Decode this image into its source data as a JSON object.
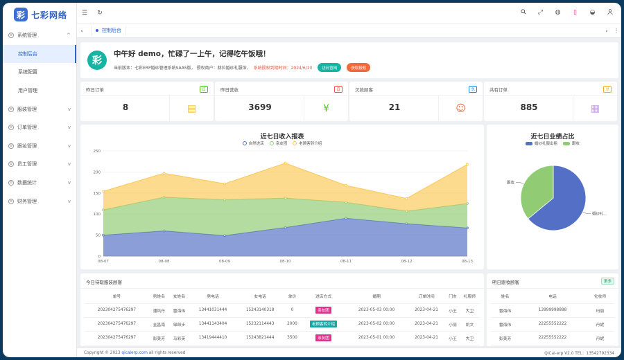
{
  "app": {
    "logo_char": "彩",
    "name": "七彩网络"
  },
  "sidebar": {
    "items": [
      {
        "label": "系统管理",
        "type": "group",
        "chev": "^"
      },
      {
        "label": "控制后台",
        "type": "sub",
        "active": true
      },
      {
        "label": "系统配置",
        "type": "sub"
      },
      {
        "label": "用户管理",
        "type": "sub"
      },
      {
        "label": "服装管理",
        "type": "group",
        "chev": "v"
      },
      {
        "label": "订单管理",
        "type": "group",
        "chev": "v"
      },
      {
        "label": "跟妆管理",
        "type": "group",
        "chev": "v"
      },
      {
        "label": "员工管理",
        "type": "group",
        "chev": "v"
      },
      {
        "label": "数据统计",
        "type": "group",
        "chev": "v"
      },
      {
        "label": "财务管理",
        "type": "group",
        "chev": "v"
      }
    ]
  },
  "topbar": {
    "left_icons": [
      "menu-icon",
      "refresh-icon"
    ],
    "right_icons": [
      "search-icon",
      "fullscreen-icon",
      "globe-icon",
      "phone-icon",
      "skin-icon",
      "user-icon"
    ]
  },
  "tabs": {
    "active_label": "控制后台"
  },
  "welcome": {
    "greeting": "中午好 demo，忙碌了一上午，记得吃午饭哦！",
    "version_text": "当前版本：七彩ERP婚纱管理系统SAAS版，  授权商户：赫拉婚纱礼服馆，",
    "expire_text": "系统授权到期时间：2024/6/10",
    "btn_site": "访问官网",
    "btn_auth": "获取授权"
  },
  "stats": [
    {
      "title": "昨日订单",
      "badge": "日",
      "value": "8",
      "badge_color": "#52c41a",
      "icon_color": "#f5c242"
    },
    {
      "title": "昨日营收",
      "badge": "日",
      "value": "3699",
      "badge_color": "#ff4d4f",
      "icon_color": "#52c41a"
    },
    {
      "title": "欠款顾客",
      "badge": "总",
      "value": "21",
      "badge_color": "#1890ff",
      "icon_color": "#f26a3b"
    },
    {
      "title": "共有订单",
      "badge": "总",
      "value": "885",
      "badge_color": "#faad14",
      "icon_color": "#c9a4e8"
    }
  ],
  "chart_data": [
    {
      "type": "area",
      "title": "近七日收入报表",
      "stacked": true,
      "x": [
        "08-07",
        "08-08",
        "08-09",
        "08-10",
        "08-11",
        "08-12",
        "08-13"
      ],
      "ylim": [
        0,
        250
      ],
      "yticks": [
        0,
        50,
        100,
        150,
        200,
        250
      ],
      "series": [
        {
          "name": "自然进店",
          "values": [
            50,
            60,
            49,
            68,
            90,
            77,
            67
          ],
          "color": "#5470c6"
        },
        {
          "name": "亲友团",
          "values": [
            60,
            80,
            85,
            70,
            38,
            30,
            58
          ],
          "color": "#91cc75"
        },
        {
          "name": "老顾客转介绍",
          "values": [
            44,
            57,
            38,
            83,
            40,
            30,
            93
          ],
          "color": "#fac858"
        }
      ]
    },
    {
      "type": "pie",
      "title": "近七日业绩占比",
      "slices": [
        {
          "name": "婚纱礼服出租",
          "value": 64,
          "label": "婚纱礼...",
          "color": "#5470c6"
        },
        {
          "name": "跟妆",
          "value": 36,
          "label": "跟妆",
          "color": "#91cc75"
        }
      ]
    }
  ],
  "left_table": {
    "title": "今日待取服装顾客",
    "headers": [
      "单号",
      "男姓名",
      "女姓名",
      "男电话",
      "女电话",
      "单价",
      "进店方式",
      "婚期",
      "订单时间",
      "门市",
      "礼服师"
    ],
    "rows": [
      [
        "202304275476297",
        "潘风丹",
        "雷海伟",
        "13441031444",
        "15243140318",
        "0",
        "亲友团",
        "2023-05-03 00:00",
        "2023-04-21",
        "小王",
        "大卫"
      ],
      [
        "202304275476297",
        "金昌南",
        "邹郎步",
        "13441143404",
        "15232114443",
        "2000",
        "老顾客转介绍",
        "2023-05-02 00:00",
        "2023-04-21",
        "小丽",
        "凯文"
      ],
      [
        "202304275476297",
        "彭美芳",
        "马彩英",
        "13419444410",
        "15243821444",
        "3500",
        "亲友团",
        "2023-05-01 00:00",
        "2023-04-21",
        "小王",
        "大卫"
      ]
    ],
    "tag_colors": {
      "亲友团": "#e0338f",
      "老顾客转介绍": "#17a6a6"
    }
  },
  "right_table": {
    "title": "明日跟妆顾客",
    "more": "更多",
    "headers": [
      "姓名",
      "电话",
      "化妆师"
    ],
    "rows": [
      [
        "雷海伟",
        "13999998888",
        "玛丽"
      ],
      [
        "雷海伟",
        "22255552222",
        "丹妮"
      ],
      [
        "彭美芳",
        "22255552222",
        "丹妮"
      ]
    ]
  },
  "footer": {
    "copyright_pre": "Copyright © 2023",
    "copyright_link": "qicaierp.com",
    "copyright_post": "all rights reserved",
    "right": "QiCai-erp V2.0 TEL：13542792334"
  }
}
